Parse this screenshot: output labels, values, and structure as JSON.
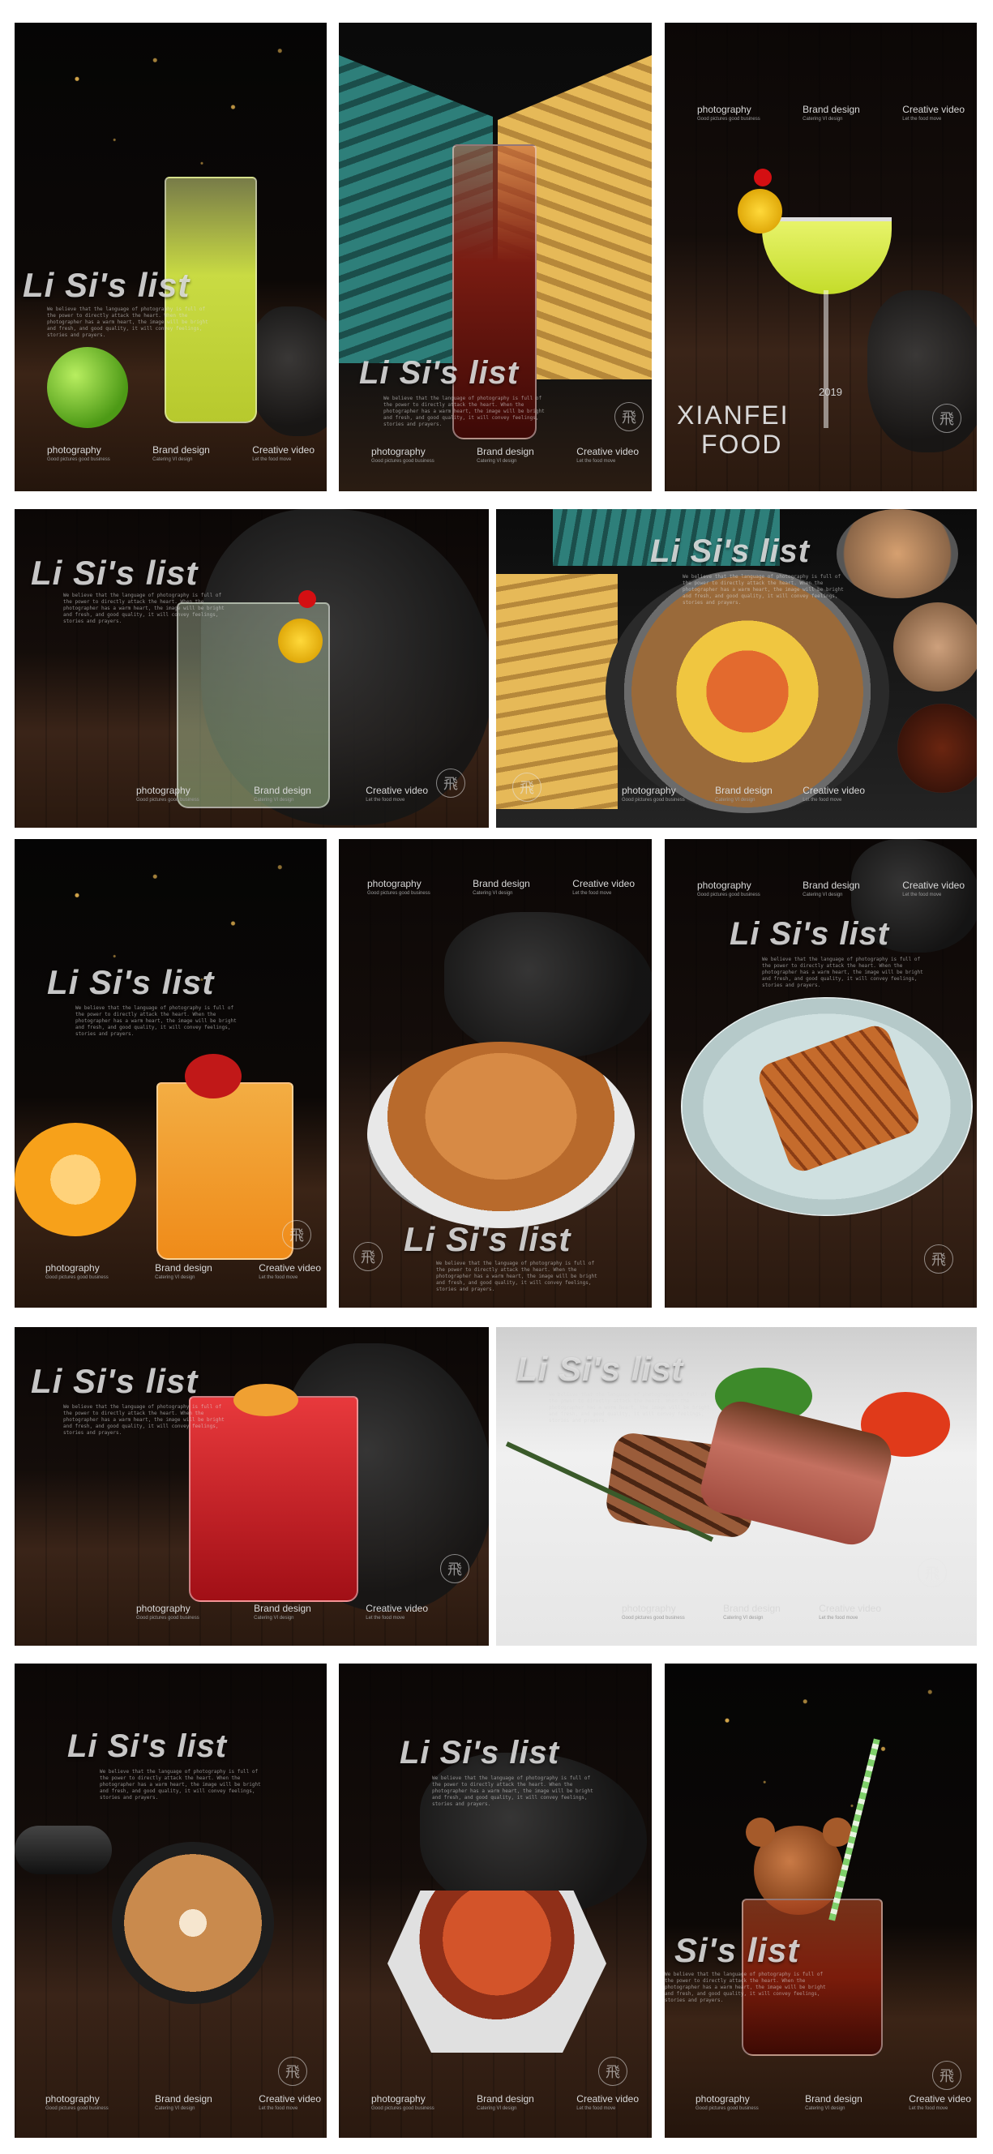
{
  "watermark": {
    "title": "Li Si's list",
    "blurb": "We believe that the language of photography is full of the power to directly attack the heart. When the photographer has a warm heart, the image will be bright and fresh, and good quality, it will convey feelings, stories and prayers.",
    "seal_glyph": "飛"
  },
  "footer": {
    "photography": "photography",
    "photography_sub": "Good pictures good business",
    "brand": "Brand design",
    "brand_sub": "Catering VI design",
    "video": "Creative video",
    "video_sub": "Let the food move"
  },
  "tile3": {
    "year": "2019",
    "line1": "XIANFEI",
    "line2": "FOOD"
  },
  "tiles": [
    {
      "subject": "lemonade-with-lime"
    },
    {
      "subject": "splashing-tea-drink"
    },
    {
      "subject": "green-cocktail"
    },
    {
      "subject": "cucumber-soda"
    },
    {
      "subject": "salmon-grain-bowl"
    },
    {
      "subject": "orange-fruit-drink"
    },
    {
      "subject": "fried-fish-strips"
    },
    {
      "subject": "fried-fish-on-plate"
    },
    {
      "subject": "red-iced-drink"
    },
    {
      "subject": "grilled-steak"
    },
    {
      "subject": "latte-art-coffee"
    },
    {
      "subject": "spicy-crab"
    },
    {
      "subject": "bear-ice-tea"
    }
  ]
}
